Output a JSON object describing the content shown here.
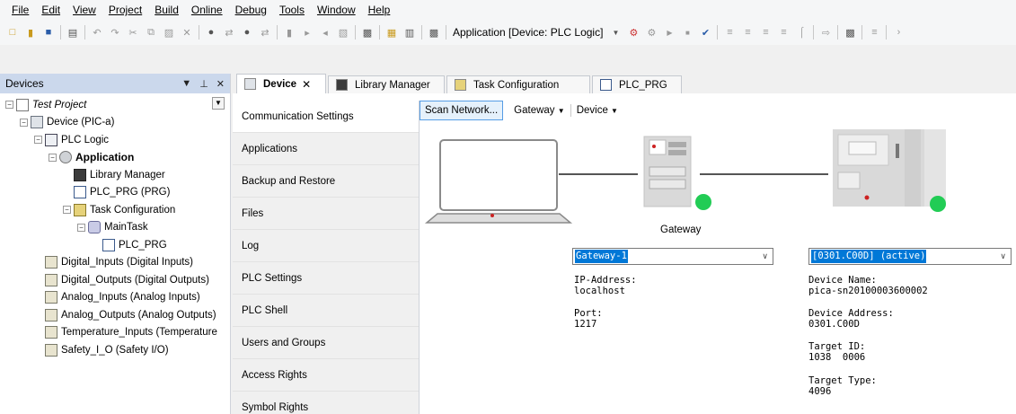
{
  "menu": [
    "File",
    "Edit",
    "View",
    "Project",
    "Build",
    "Online",
    "Debug",
    "Tools",
    "Window",
    "Help"
  ],
  "toolbar": {
    "active_app": "Application [Device: PLC Logic]"
  },
  "devices_panel": {
    "title": "Devices",
    "pin": "❘",
    "tree": [
      {
        "label": "Test Project",
        "level": 0,
        "icon": "project-icon",
        "italic": true,
        "expand": "-"
      },
      {
        "label": "Device (PIC-a)",
        "level": 1,
        "icon": "device-icon",
        "expand": "-"
      },
      {
        "label": "PLC Logic",
        "level": 2,
        "icon": "plc-logic-icon",
        "expand": "-"
      },
      {
        "label": "Application",
        "level": 3,
        "icon": "application-icon",
        "bold": true,
        "expand": "-"
      },
      {
        "label": "Library Manager",
        "level": 4,
        "icon": "library-manager-icon"
      },
      {
        "label": "PLC_PRG (PRG)",
        "level": 4,
        "icon": "program-icon"
      },
      {
        "label": "Task Configuration",
        "level": 4,
        "icon": "task-config-icon",
        "expand": "-"
      },
      {
        "label": "MainTask",
        "level": 5,
        "icon": "main-task-icon",
        "expand": "-"
      },
      {
        "label": "PLC_PRG",
        "level": 6,
        "icon": "program-call-icon"
      },
      {
        "label": "Digital_Inputs (Digital Inputs)",
        "level": 2,
        "icon": "io-icon"
      },
      {
        "label": "Digital_Outputs (Digital Outputs)",
        "level": 2,
        "icon": "io-icon"
      },
      {
        "label": "Analog_Inputs (Analog Inputs)",
        "level": 2,
        "icon": "io-icon"
      },
      {
        "label": "Analog_Outputs (Analog Outputs)",
        "level": 2,
        "icon": "io-icon"
      },
      {
        "label": "Temperature_Inputs (Temperature",
        "level": 2,
        "icon": "io-icon"
      },
      {
        "label": "Safety_I_O (Safety I/O)",
        "level": 2,
        "icon": "io-icon"
      }
    ]
  },
  "tabs": [
    {
      "label": "Device",
      "icon": "device-icon",
      "active": true
    },
    {
      "label": "Library Manager",
      "icon": "library-manager-icon"
    },
    {
      "label": "Task Configuration",
      "icon": "task-config-icon"
    },
    {
      "label": "PLC_PRG",
      "icon": "program-icon"
    }
  ],
  "device_nav": [
    "Communication Settings",
    "Applications",
    "Backup and Restore",
    "Files",
    "Log",
    "PLC Settings",
    "PLC Shell",
    "Users and Groups",
    "Access Rights",
    "Symbol Rights"
  ],
  "comm": {
    "scan_button": "Scan Network...",
    "gateway_menu": "Gateway",
    "device_menu": "Device",
    "gateway_label": "Gateway",
    "gateway_select": "Gateway-1",
    "ip_label": "IP-Address:",
    "ip_value": "localhost",
    "port_label": "Port:",
    "port_value": "1217",
    "device_select": "[0301.C00D] (active)",
    "device_name_label": "Device Name:",
    "device_name_value": "pica-sn20100003600002",
    "device_address_label": "Device Address:",
    "device_address_value": "0301.C00D",
    "target_id_label": "Target ID:",
    "target_id_value": "1038  0006",
    "target_type_label": "Target Type:",
    "target_type_value": "4096",
    "status_color": "#22cc55"
  }
}
